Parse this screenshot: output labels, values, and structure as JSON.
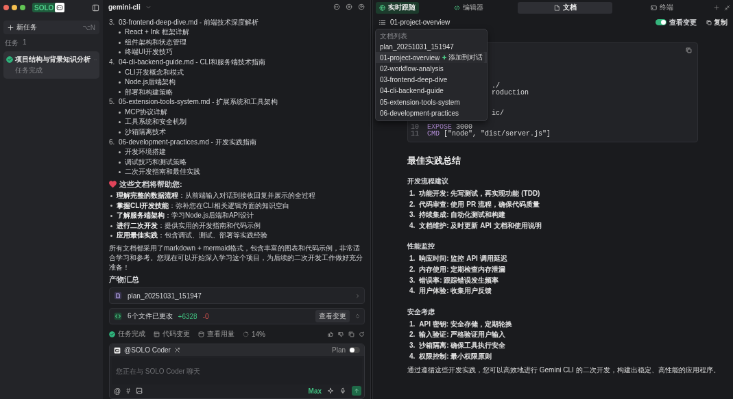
{
  "app": {
    "badge": "SOLO"
  },
  "sidebar": {
    "new_task": {
      "label": "新任务",
      "shortcut": "⌥N"
    },
    "tasks_heading": {
      "label": "任务",
      "count": "1"
    },
    "tasks": [
      {
        "title": "项目结构与背景知识分析",
        "status": "任务完成",
        "done": true,
        "selected": true
      }
    ]
  },
  "chat": {
    "project": "gemini-cli",
    "doc_list": [
      {
        "number": "3.",
        "title": "03-frontend-deep-dive.md - 前端技术深度解析",
        "points": [
          "React + Ink 框架详解",
          "组件架构和状态管理",
          "终端UI开发技巧"
        ]
      },
      {
        "number": "4.",
        "title": "04-cli-backend-guide.md - CLI和服务端技术指南",
        "points": [
          "CLI开发概念和模式",
          "Node.js后端架构",
          "部署和构建策略"
        ]
      },
      {
        "number": "5.",
        "title": "05-extension-tools-system.md - 扩展系统和工具架构",
        "points": [
          "MCP协议详解",
          "工具系统和安全机制",
          "沙箱隔离技术"
        ]
      },
      {
        "number": "6.",
        "title": "06-development-practices.md - 开发实践指南",
        "points": [
          "开发环境搭建",
          "调试技巧和测试策略",
          "二次开发指南和最佳实践"
        ]
      }
    ],
    "help_heading": "这些文档将帮助您:",
    "help_points": [
      "**理解完整的数据流程**：从前端输入对话到接收回复并展示的全过程",
      "**掌握CLI开发技能**：弥补您在CLI相关逻辑方面的知识空白",
      "**了解服务端架构**：学习Node.js后端和API设计",
      "**进行二次开发**：提供实用的开发指南和代码示例",
      "**应用最佳实践**：包含调试、测试、部署等实践经验"
    ],
    "summary": "所有文档都采用了markdown + mermaid格式，包含丰富的图表和代码示例，非常适合学习和参考。您现在可以开始深入学习这个项目，为后续的二次开发工作做好充分准备！",
    "artifacts_heading": "产物汇总",
    "artifact": {
      "name": "plan_20251031_151947"
    },
    "changes": {
      "label": "6个文件已更改",
      "added": "+6328",
      "removed": "-0",
      "button": "查看变更"
    },
    "status_row": [
      {
        "kind": "done",
        "label": "任务完成"
      },
      {
        "kind": "code",
        "label": "代码变更"
      },
      {
        "kind": "usage",
        "label": "查看用量"
      },
      {
        "kind": "progress",
        "label": "14%"
      }
    ],
    "composer": {
      "agent": "@SOLO Coder",
      "plan_label": "Plan",
      "plan_on": false,
      "placeholder": "您正在与 SOLO Coder 聊天",
      "tools": [
        "@",
        "#"
      ],
      "mode": "Max"
    }
  },
  "panel": {
    "live_follow": {
      "label": "实时跟随",
      "on": true
    },
    "tabs": [
      {
        "label": "编辑器",
        "kind": "editor",
        "selected": false
      },
      {
        "label": "文档",
        "kind": "docs",
        "selected": true
      },
      {
        "label": "终端",
        "kind": "terminal",
        "selected": false
      }
    ],
    "doc_title": "01-project-overview",
    "view_changes": {
      "label": "查看变更",
      "on": true
    },
    "copy": "复制",
    "doc_menu": {
      "heading": "文档列表",
      "items": [
        {
          "label": "plan_20251031_151947",
          "selected": false
        },
        {
          "label": "01-project-overview",
          "selected": true,
          "action": "添加到对话"
        },
        {
          "label": "02-workflow-analysis",
          "selected": false
        },
        {
          "label": "03-frontend-deep-dive",
          "selected": false
        },
        {
          "label": "04-cli-backend-guide",
          "selected": false
        },
        {
          "label": "05-extension-tools-system",
          "selected": false
        },
        {
          "label": "06-development-practices",
          "selected": false
        }
      ]
    },
    "code_lines": [
      {
        "kind": "covered"
      },
      {
        "kind": "covered"
      },
      {
        "kind": "covered"
      },
      {
        "kind": "partial",
        "code": "./"
      },
      {
        "kind": "partial",
        "code": "roduction"
      },
      {
        "kind": "covered"
      },
      {
        "kind": "covered"
      },
      {
        "kind": "partial",
        "code": "ic/"
      },
      {
        "kind": "covered"
      },
      {
        "kind": "full",
        "number": "10",
        "keyword": "EXPOSE",
        "code": "3000"
      },
      {
        "kind": "full",
        "number": "11",
        "keyword": "CMD",
        "code": "[\"node\", \"dist/server.js\"]"
      }
    ],
    "heading": "最佳实践总结",
    "sections": [
      {
        "title": "开发流程建议",
        "items": [
          {
            "number": "1.",
            "text": "功能开发: 先写测试，再实现功能 (TDD)"
          },
          {
            "number": "2.",
            "text": "代码审查: 使用 PR 流程，确保代码质量"
          },
          {
            "number": "3.",
            "text": "持续集成: 自动化测试和构建"
          },
          {
            "number": "4.",
            "text": "文档维护: 及时更新 API 文档和使用说明"
          }
        ]
      },
      {
        "title": "性能监控",
        "items": [
          {
            "number": "1.",
            "text": "响应时间: 监控 API 调用延迟"
          },
          {
            "number": "2.",
            "text": "内存使用: 定期检查内存泄漏"
          },
          {
            "number": "3.",
            "text": "错误率: 跟踪错误发生频率"
          },
          {
            "number": "4.",
            "text": "用户体验: 收集用户反馈"
          }
        ]
      },
      {
        "title": "安全考虑",
        "items": [
          {
            "number": "1.",
            "text": "API 密钥: 安全存储，定期轮换"
          },
          {
            "number": "2.",
            "text": "输入验证: 严格验证用户输入"
          },
          {
            "number": "3.",
            "text": "沙箱隔离: 确保工具执行安全"
          },
          {
            "number": "4.",
            "text": "权限控制: 最小权限原则"
          }
        ]
      }
    ],
    "closing": "通过遵循这些开发实践，您可以高效地进行 Gemini CLI 的二次开发，构建出稳定、高性能的应用程序。"
  }
}
